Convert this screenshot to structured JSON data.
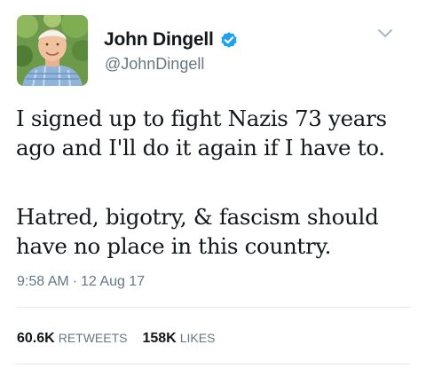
{
  "author": {
    "display_name": "John Dingell",
    "handle": "@JohnDingell",
    "verified": true
  },
  "tweet": {
    "lines_para1": [
      "I signed up to fight Nazis 73 years",
      "ago and I'll do it again if I have to."
    ],
    "lines_para2": [
      "Hatred, bigotry, & fascism should",
      "have no place in this country."
    ],
    "time": "9:58 AM",
    "separator": "·",
    "date": "12 Aug 17"
  },
  "stats": {
    "retweets_count": "60.6K",
    "retweets_label": "RETWEETS",
    "likes_count": "158K",
    "likes_label": "LIKES"
  },
  "icons": {
    "verified": "verified-badge-icon",
    "menu": "chevron-down-icon"
  },
  "colors": {
    "verified_blue": "#1da1f2",
    "secondary_text": "#657786",
    "divider": "#e1e8ed"
  }
}
